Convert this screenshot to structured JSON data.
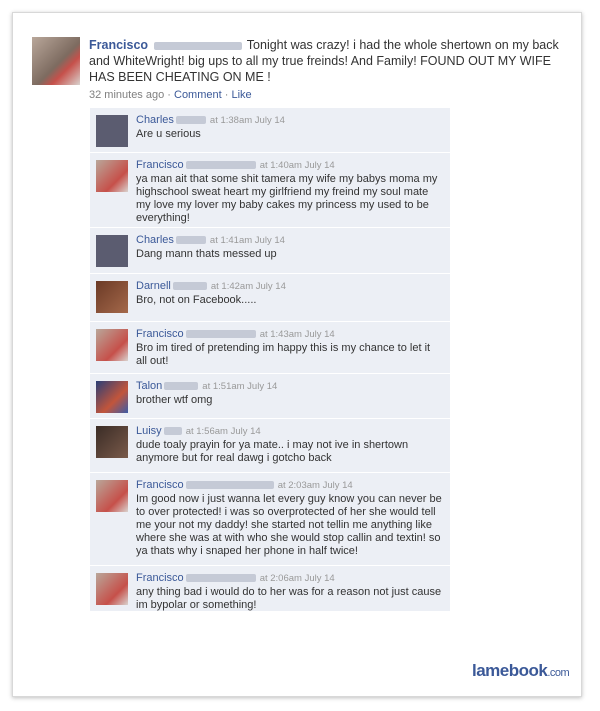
{
  "post": {
    "author": "Francisco",
    "text": "Tonight was crazy! i had the whole shertown on my back and WhiteWright! big ups to all my true freinds! And Family! FOUND OUT MY WIFE HAS BEEN CHEATING ON ME !",
    "time": "32 minutes ago",
    "comment_link": "Comment",
    "like_link": "Like"
  },
  "comments": [
    {
      "name": "Charles",
      "time": "at 1:38am July 14",
      "text": "Are u serious"
    },
    {
      "name": "Francisco",
      "time": "at 1:40am July 14",
      "text": "ya man ait that some shit tamera my wife my babys moma my highschool sweat heart my girlfriend my freind my soul mate my love my lover my baby cakes my princess my used to be everything!"
    },
    {
      "name": "Charles",
      "time": "at 1:41am July 14",
      "text": "Dang mann thats messed up"
    },
    {
      "name": "Darnell",
      "time": "at 1:42am July 14",
      "text": "Bro, not on Facebook....."
    },
    {
      "name": "Francisco",
      "time": "at 1:43am July 14",
      "text": "Bro im tired of pretending im happy this is my chance to let it all out!"
    },
    {
      "name": "Talon",
      "time": "at 1:51am July 14",
      "text": "brother wtf omg"
    },
    {
      "name": "Luisy",
      "time": "at 1:56am July 14",
      "text": "dude toaly prayin for ya mate.. i may not ive in shertown anymore but for real dawg i gotcho back"
    },
    {
      "name": "Francisco",
      "time": "at 2:03am July 14",
      "text": "Im good now i just wanna let every guy know you can never be to over protected! i was so overprotected of her she would tell me your not my daddy! she started not tellin me anything like where she was at with who she would stop callin and textin! so ya thats why i snaped her phone in half twice!"
    },
    {
      "name": "Francisco",
      "time": "at 2:06am July 14",
      "text": "any thing bad i would do to her was for a reason not just cause im bypolar or something!"
    }
  ],
  "watermark": {
    "brand": "lamebook",
    "suffix": ".com"
  },
  "colors": {
    "link": "#3b5998",
    "comment_bg": "#eceff5"
  }
}
